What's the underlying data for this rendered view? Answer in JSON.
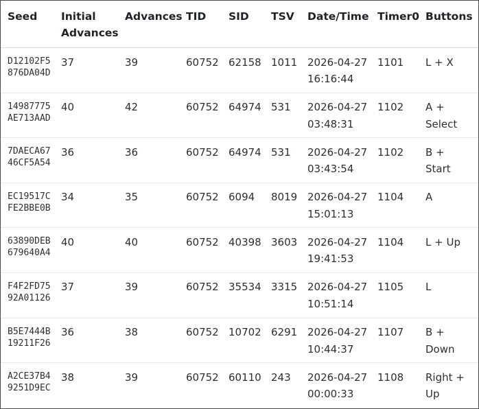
{
  "columns": [
    "Seed",
    "Initial Advances",
    "Advances",
    "TID",
    "SID",
    "TSV",
    "Date/Time",
    "Timer0",
    "Buttons"
  ],
  "header_lines": {
    "initial_advances": [
      "Initial",
      "Advances"
    ]
  },
  "rows": [
    {
      "seed": [
        "D12102F5",
        "876DA04D"
      ],
      "initial_advances": "37",
      "advances": "39",
      "tid": "60752",
      "sid": "62158",
      "tsv": "1011",
      "date": "2026-04-27",
      "time": "16:16:44",
      "timer0": "1101",
      "buttons": [
        "L + X"
      ]
    },
    {
      "seed": [
        "14987775",
        "AE713AAD"
      ],
      "initial_advances": "40",
      "advances": "42",
      "tid": "60752",
      "sid": "64974",
      "tsv": "531",
      "date": "2026-04-27",
      "time": "03:48:31",
      "timer0": "1102",
      "buttons": [
        "A +",
        "Select"
      ]
    },
    {
      "seed": [
        "7DAECA67",
        "46CF5A54"
      ],
      "initial_advances": "36",
      "advances": "36",
      "tid": "60752",
      "sid": "64974",
      "tsv": "531",
      "date": "2026-04-27",
      "time": "03:43:54",
      "timer0": "1102",
      "buttons": [
        "B +",
        "Start"
      ]
    },
    {
      "seed": [
        "EC19517C",
        "FE2BBE0B"
      ],
      "initial_advances": "34",
      "advances": "35",
      "tid": "60752",
      "sid": "6094",
      "tsv": "8019",
      "date": "2026-04-27",
      "time": "15:01:13",
      "timer0": "1104",
      "buttons": [
        "A"
      ]
    },
    {
      "seed": [
        "63890DEB",
        "679640A4"
      ],
      "initial_advances": "40",
      "advances": "40",
      "tid": "60752",
      "sid": "40398",
      "tsv": "3603",
      "date": "2026-04-27",
      "time": "19:41:53",
      "timer0": "1104",
      "buttons": [
        "L + Up"
      ]
    },
    {
      "seed": [
        "F4F2FD75",
        "92A01126"
      ],
      "initial_advances": "37",
      "advances": "39",
      "tid": "60752",
      "sid": "35534",
      "tsv": "3315",
      "date": "2026-04-27",
      "time": "10:51:14",
      "timer0": "1105",
      "buttons": [
        "L"
      ]
    },
    {
      "seed": [
        "B5E7444B",
        "19211F26"
      ],
      "initial_advances": "36",
      "advances": "38",
      "tid": "60752",
      "sid": "10702",
      "tsv": "6291",
      "date": "2026-04-27",
      "time": "10:44:37",
      "timer0": "1107",
      "buttons": [
        "B +",
        "Down"
      ]
    },
    {
      "seed": [
        "A2CE37B4",
        "9251D9EC"
      ],
      "initial_advances": "38",
      "advances": "39",
      "tid": "60752",
      "sid": "60110",
      "tsv": "243",
      "date": "2026-04-27",
      "time": "00:00:33",
      "timer0": "1108",
      "buttons": [
        "Right +",
        "Up"
      ]
    }
  ]
}
